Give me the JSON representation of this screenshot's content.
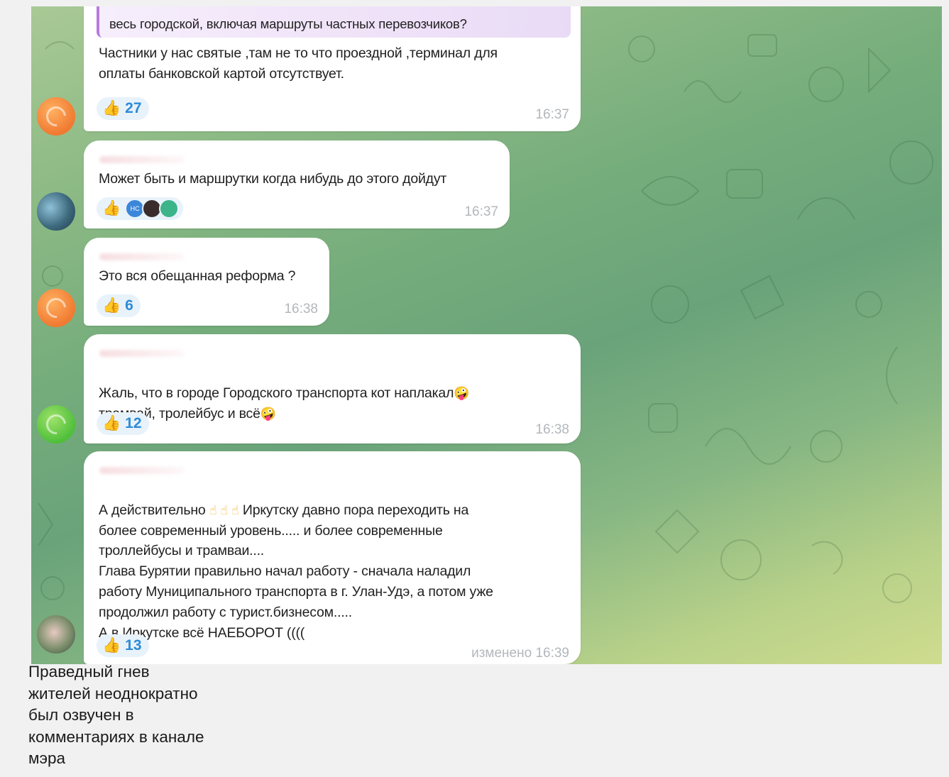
{
  "messages": [
    {
      "quote": "весь городской, включая маршруты частных перевозчиков?",
      "text": "Частники у нас святые ,там не то что проездной ,терминал для\nоплаты банковской картой отсутствует.",
      "reaction": {
        "emoji": "👍",
        "count": "27"
      },
      "time": "16:37",
      "avatar": "orange"
    },
    {
      "text": "Может быть и маршрутки когда нибудь до этого дойдут",
      "reaction": {
        "emoji": "👍",
        "avatars": [
          "HC",
          "",
          ""
        ]
      },
      "time": "16:37",
      "avatar": "photo"
    },
    {
      "text": "Это вся обещанная реформа ?",
      "reaction": {
        "emoji": "👍",
        "count": "6"
      },
      "time": "16:38",
      "avatar": "orange"
    },
    {
      "text_line1": "Жаль, что в городе Городского транспорта кот наплакал",
      "text_line2": "трамвай, тролейбус и всё",
      "emoji": "🤪",
      "reaction": {
        "emoji": "👍",
        "count": "12"
      },
      "time": "16:38",
      "avatar": "green"
    },
    {
      "text_start": "А действительно",
      "fingers": "☝ ☝ ☝",
      "text_end": "Иркутску давно пора переходить на",
      "text_rest": "более современный уровень..... и более современные\nтроллейбусы и трамваи....\nГлава Бурятии правильно начал работу - сначала наладил\nработу Муниципального транспорта в г. Улан-Удэ,  а потом уже\nпродолжил работу с турист.бизнесом.....\nА в Иркутске  всё  НАЕБОРОТ  ((((",
      "reaction": {
        "emoji": "👍",
        "count": "13"
      },
      "time": "изменено 16:39",
      "avatar": "photo2"
    }
  ],
  "caption": "Праведный гнев\nжителей неоднократно\nбыл озвучен в\nкомментариях в канале\nмэра"
}
